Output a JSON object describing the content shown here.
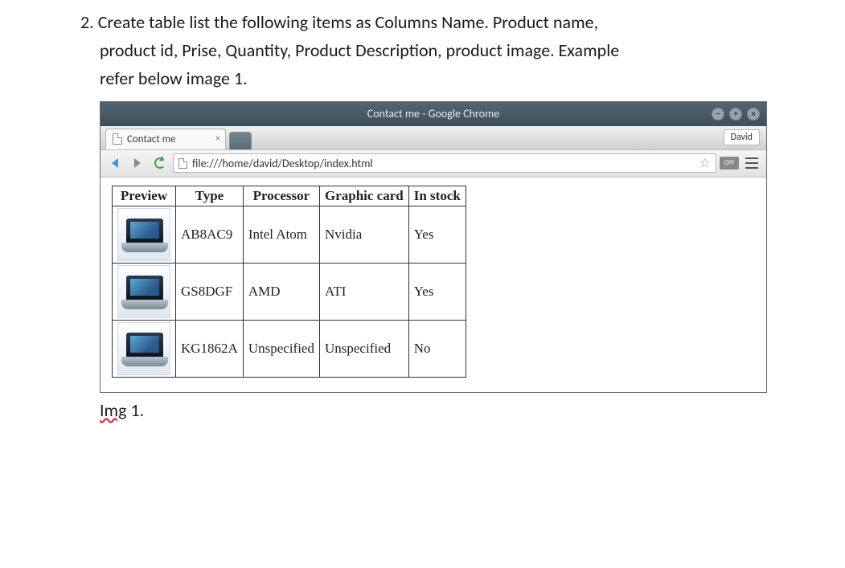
{
  "question": {
    "number": "2.",
    "line1": "Create table list the following items as Columns Name. Product name,",
    "line2": "product id, Prise, Quantity, Product Description, product image. Example",
    "line3": "refer below image 1."
  },
  "browser": {
    "window_title": "Contact me - Google Chrome",
    "tab_title": "Contact me",
    "user_label": "David",
    "url": "file:///home/david/Desktop/index.html",
    "off_label": "OFF"
  },
  "table": {
    "headers": {
      "preview": "Preview",
      "type": "Type",
      "processor": "Processor",
      "graphic": "Graphic card",
      "stock": "In stock"
    },
    "rows": [
      {
        "type": "AB8AC9",
        "processor": "Intel Atom",
        "graphic": "Nvidia",
        "stock": "Yes"
      },
      {
        "type": "GS8DGF",
        "processor": "AMD",
        "graphic": "ATI",
        "stock": "Yes"
      },
      {
        "type": "KG1862A",
        "processor": "Unspecified",
        "graphic": "Unspecified",
        "stock": "No"
      }
    ]
  },
  "caption": {
    "label_word": "Img",
    "label_num": " 1."
  }
}
